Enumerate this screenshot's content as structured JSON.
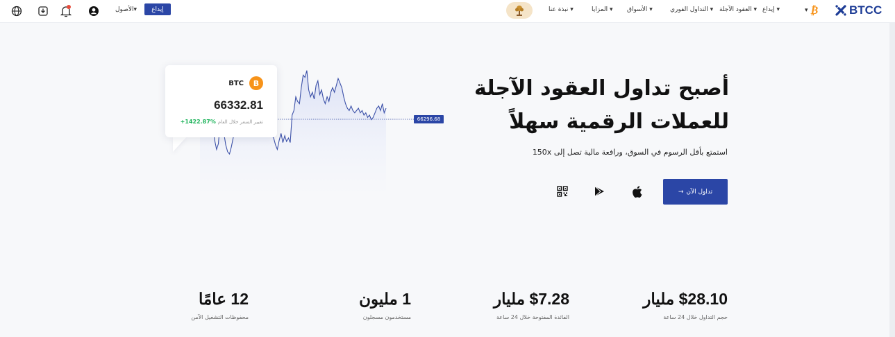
{
  "header": {
    "logo_text": "BTCC",
    "nav": {
      "deposit": "إيداع",
      "futures": "العقود الآجلة",
      "spot": "التداول الفوري",
      "markets": "الأسواق",
      "features": "المزايا",
      "about": "نبذة عنا"
    },
    "dropdown_arrow": "▾",
    "account_link": "الأصول",
    "deposit_button": "إيداع",
    "icons": [
      "globe-icon",
      "download-icon",
      "bell-icon",
      "user-icon",
      "tree-icon",
      "bitcoin-icon"
    ],
    "colors": {
      "brand": "#1d3c96",
      "button": "#2b46a6",
      "notification_dot": "#e74c3c"
    }
  },
  "hero": {
    "title_line1": "أصبح تداول العقود الآجلة",
    "title_line2": "للعملات الرقمية سهلاً",
    "subtitle": "استمتع بأقل الرسوم في السوق، ورافعة مالية تصل إلى 150x",
    "trade_button": "تداول الآن",
    "trade_button_arrow": "→",
    "app_icons": [
      "qr-code-icon",
      "google-play-icon",
      "apple-icon"
    ]
  },
  "price_card": {
    "coin": "BTC",
    "price": "66332.81",
    "change_label": "تغيير السعر خلال العام",
    "change_value": "+1422.87%",
    "current_price_tag": "66296.68"
  },
  "chart_data": {
    "type": "area",
    "series": [
      {
        "values": [
          0.42,
          0.56,
          0.6,
          0.52,
          0.47,
          0.66,
          0.58,
          0.5,
          0.38,
          0.3,
          0.35,
          0.55,
          0.62,
          0.44,
          0.34,
          0.28,
          0.26,
          0.32,
          0.4,
          0.46,
          0.5,
          0.6,
          0.74,
          0.86,
          0.88,
          0.96,
          0.92,
          0.84,
          0.88,
          0.86,
          0.82,
          0.9,
          0.86,
          0.8,
          0.7,
          0.6,
          0.64,
          0.56,
          0.5,
          0.42,
          0.4,
          0.34,
          0.3,
          0.38,
          0.44,
          0.36,
          0.42,
          0.37,
          0.4,
          0.36,
          0.6,
          0.64,
          0.76,
          0.72,
          0.7,
          0.84,
          0.95,
          0.93,
          0.99,
          0.82,
          0.76,
          0.8,
          0.74,
          0.86,
          0.9,
          0.78,
          0.82,
          0.74,
          0.7,
          0.76,
          0.72,
          0.8,
          0.84,
          0.8,
          0.86,
          0.92,
          0.88,
          0.84,
          0.76,
          0.7,
          0.66,
          0.64,
          0.68,
          0.64,
          0.62,
          0.64,
          0.66,
          0.62,
          0.64,
          0.6,
          0.62,
          0.58,
          0.6,
          0.56,
          0.58,
          0.62,
          0.66,
          0.68,
          0.64,
          0.7,
          0.62,
          0.66
        ]
      }
    ],
    "line_color": "#3b50a8",
    "fill_color": "#dfe4f6"
  },
  "stats": [
    {
      "value": "$28.10 مليار",
      "label": "حجم التداول خلال 24 ساعة"
    },
    {
      "value": "$7.28 مليار",
      "label": "الفائدة المفتوحة خلال 24 ساعة"
    },
    {
      "value": "1 مليون",
      "label": "مستخدمون مسجلون"
    },
    {
      "value": "12 عامًا",
      "label": "محفوظات التشغيل الآمن"
    }
  ]
}
